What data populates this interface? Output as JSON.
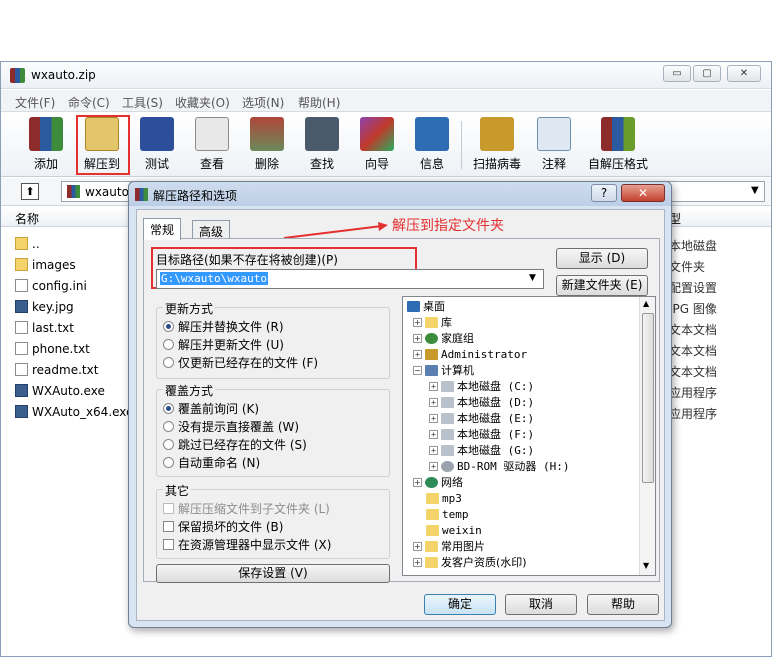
{
  "window": {
    "title": "wxauto.zip",
    "controls": {
      "minimize": "▭",
      "maximize": "▢",
      "close": "✕"
    }
  },
  "menu": [
    "文件(F)",
    "命令(C)",
    "工具(S)",
    "收藏夹(O)",
    "选项(N)",
    "帮助(H)"
  ],
  "toolbar": [
    {
      "label": "添加",
      "icon": "add-archive-icon",
      "color": "#c0392b"
    },
    {
      "label": "解压到",
      "icon": "extract-to-icon",
      "color": "#d4a017"
    },
    {
      "label": "测试",
      "icon": "test-icon",
      "color": "#2d4f9b"
    },
    {
      "label": "查看",
      "icon": "view-icon",
      "color": "#8a8a8a"
    },
    {
      "label": "删除",
      "icon": "delete-icon",
      "color": "#b0463a"
    },
    {
      "label": "查找",
      "icon": "find-icon",
      "color": "#4a5a6a"
    },
    {
      "label": "向导",
      "icon": "wizard-icon",
      "color": "#8e44ad"
    },
    {
      "label": "信息",
      "icon": "info-icon",
      "color": "#2e6db4"
    },
    {
      "label": "扫描病毒",
      "icon": "scan-virus-icon",
      "color": "#c79a2b"
    },
    {
      "label": "注释",
      "icon": "comment-icon",
      "color": "#6d8fb0"
    },
    {
      "label": "自解压格式",
      "icon": "sfx-icon",
      "color": "#6a9c2b"
    }
  ],
  "address": {
    "path": "wxauto"
  },
  "file_list": {
    "column_name": "名称",
    "items": [
      {
        "name": "..",
        "kind": "folder"
      },
      {
        "name": "images",
        "kind": "folder"
      },
      {
        "name": "config.ini",
        "kind": "file"
      },
      {
        "name": "key.jpg",
        "kind": "image"
      },
      {
        "name": "last.txt",
        "kind": "file"
      },
      {
        "name": "phone.txt",
        "kind": "file"
      },
      {
        "name": "readme.txt",
        "kind": "file"
      },
      {
        "name": "WXAuto.exe",
        "kind": "exe"
      },
      {
        "name": "WXAuto_x64.exe",
        "kind": "exe"
      }
    ],
    "right_column": {
      "header": "型",
      "values": [
        "本地磁盘",
        "文件夹",
        "配置设置",
        "JPG 图像",
        "文本文档",
        "文本文档",
        "文本文档",
        "应用程序",
        "应用程序"
      ]
    }
  },
  "dialog": {
    "title": "解压路径和选项",
    "help": "?",
    "close": "✕",
    "tabs": [
      "常规",
      "高级"
    ],
    "annotation": "解压到指定文件夹",
    "target_label": "目标路径(如果不存在将被创建)(P)",
    "target_value": "G:\\wxauto\\wxauto",
    "show_button": "显示 (D)",
    "new_folder_button": "新建文件夹 (E)",
    "update_mode": {
      "title": "更新方式",
      "options": [
        "解压并替换文件 (R)",
        "解压并更新文件 (U)",
        "仅更新已经存在的文件 (F)"
      ],
      "selected": 0
    },
    "overwrite_mode": {
      "title": "覆盖方式",
      "options": [
        "覆盖前询问 (K)",
        "没有提示直接覆盖 (W)",
        "跳过已经存在的文件 (S)",
        "自动重命名 (N)"
      ],
      "selected": 0
    },
    "misc": {
      "title": "其它",
      "options": [
        "解压压缩文件到子文件夹 (L)",
        "保留损坏的文件 (B)",
        "在资源管理器中显示文件 (X)"
      ]
    },
    "save_button": "保存设置 (V)",
    "tree": [
      {
        "label": "桌面",
        "icon": "desktop-icon",
        "level": 0,
        "exp": ""
      },
      {
        "label": "库",
        "icon": "library-icon",
        "level": 1,
        "exp": "+"
      },
      {
        "label": "家庭组",
        "icon": "homegroup-icon",
        "level": 1,
        "exp": "+"
      },
      {
        "label": "Administrator",
        "icon": "user-icon",
        "level": 1,
        "exp": "+"
      },
      {
        "label": "计算机",
        "icon": "computer-icon",
        "level": 1,
        "exp": "−"
      },
      {
        "label": "本地磁盘 (C:)",
        "icon": "drive-icon",
        "level": 2,
        "exp": "+"
      },
      {
        "label": "本地磁盘 (D:)",
        "icon": "drive-icon",
        "level": 2,
        "exp": "+"
      },
      {
        "label": "本地磁盘 (E:)",
        "icon": "drive-icon",
        "level": 2,
        "exp": "+"
      },
      {
        "label": "本地磁盘 (F:)",
        "icon": "drive-icon",
        "level": 2,
        "exp": "+"
      },
      {
        "label": "本地磁盘 (G:)",
        "icon": "drive-icon",
        "level": 2,
        "exp": "+"
      },
      {
        "label": "BD-ROM 驱动器 (H:)",
        "icon": "optical-drive-icon",
        "level": 2,
        "exp": "+"
      },
      {
        "label": "网络",
        "icon": "network-icon",
        "level": 1,
        "exp": "+"
      },
      {
        "label": "mp3",
        "icon": "folder-icon",
        "level": 1,
        "exp": ""
      },
      {
        "label": "temp",
        "icon": "folder-icon",
        "level": 1,
        "exp": ""
      },
      {
        "label": "weixin",
        "icon": "folder-icon",
        "level": 1,
        "exp": ""
      },
      {
        "label": "常用图片",
        "icon": "folder-icon",
        "level": 1,
        "exp": "+"
      },
      {
        "label": "发客户资质(水印)",
        "icon": "folder-icon",
        "level": 1,
        "exp": "+"
      }
    ],
    "ok_button": "确定",
    "cancel_button": "取消",
    "help_button": "帮助"
  },
  "colors": {
    "highlight": "#e53030",
    "selection": "#3399ff"
  }
}
